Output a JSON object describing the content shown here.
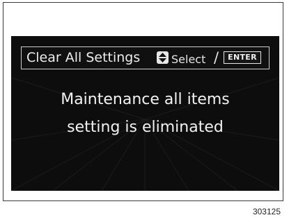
{
  "screen": {
    "header": {
      "title": "Clear All Settings",
      "select_label": "Select",
      "separator": "/",
      "enter_label": "ENTER",
      "updown_icon": "up-down-arrow-icon"
    },
    "message": {
      "line1": "Maintenance all items",
      "line2": "setting is eliminated"
    }
  },
  "figure_code": "303125",
  "colors": {
    "screen_background": "#0d0d0d",
    "text": "#f2f2f2",
    "frame": "#3a3a3a"
  }
}
